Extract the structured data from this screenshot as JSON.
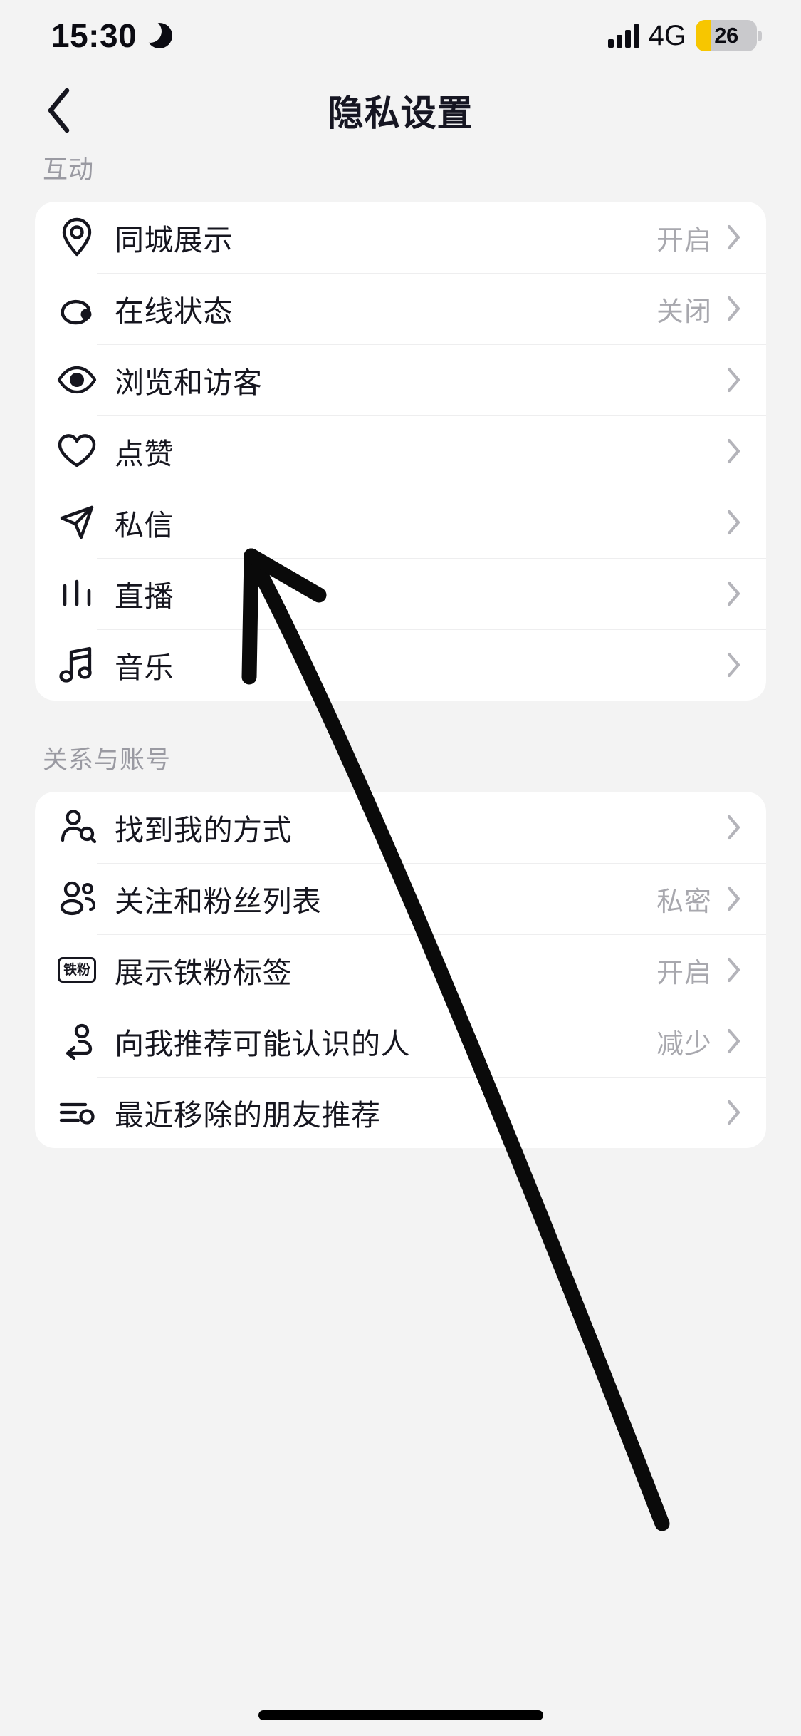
{
  "status_bar": {
    "time": "15:30",
    "moon_icon": "crescent-moon-icon",
    "network": "4G",
    "battery_percent": "26",
    "battery_level": 26,
    "battery_color": "#f7c600",
    "signal_icon": "signal-bars-icon"
  },
  "nav": {
    "back_icon": "chevron-left-icon",
    "title": "隐私设置"
  },
  "sections": [
    {
      "title": "互动",
      "rows": [
        {
          "icon": "location-pin-icon",
          "label": "同城展示",
          "value": "开启"
        },
        {
          "icon": "online-status-icon",
          "label": "在线状态",
          "value": "关闭"
        },
        {
          "icon": "eye-icon",
          "label": "浏览和访客",
          "value": ""
        },
        {
          "icon": "heart-icon",
          "label": "点赞",
          "value": ""
        },
        {
          "icon": "paper-plane-icon",
          "label": "私信",
          "value": ""
        },
        {
          "icon": "live-bars-icon",
          "label": "直播",
          "value": ""
        },
        {
          "icon": "music-note-icon",
          "label": "音乐",
          "value": ""
        }
      ]
    },
    {
      "title": "关系与账号",
      "rows": [
        {
          "icon": "person-search-icon",
          "label": "找到我的方式",
          "value": ""
        },
        {
          "icon": "two-people-icon",
          "label": "关注和粉丝列表",
          "value": "私密"
        },
        {
          "icon": "iron-fan-badge-icon",
          "label": "展示铁粉标签",
          "value": "开启",
          "badge_text": "铁粉"
        },
        {
          "icon": "person-arrow-icon",
          "label": "向我推荐可能认识的人",
          "value": "减少"
        },
        {
          "icon": "removed-list-icon",
          "label": "最近移除的朋友推荐",
          "value": ""
        }
      ]
    }
  ],
  "annotation": {
    "type": "hand-drawn-arrow",
    "color": "#0a0a0a",
    "points_to": "点赞"
  },
  "colors": {
    "page_background": "#f3f3f3",
    "card_background": "#ffffff",
    "primary_text": "#16161f",
    "secondary_text": "#a8a8ae",
    "section_title": "#9a9aa2",
    "divider": "#eeeeef"
  }
}
